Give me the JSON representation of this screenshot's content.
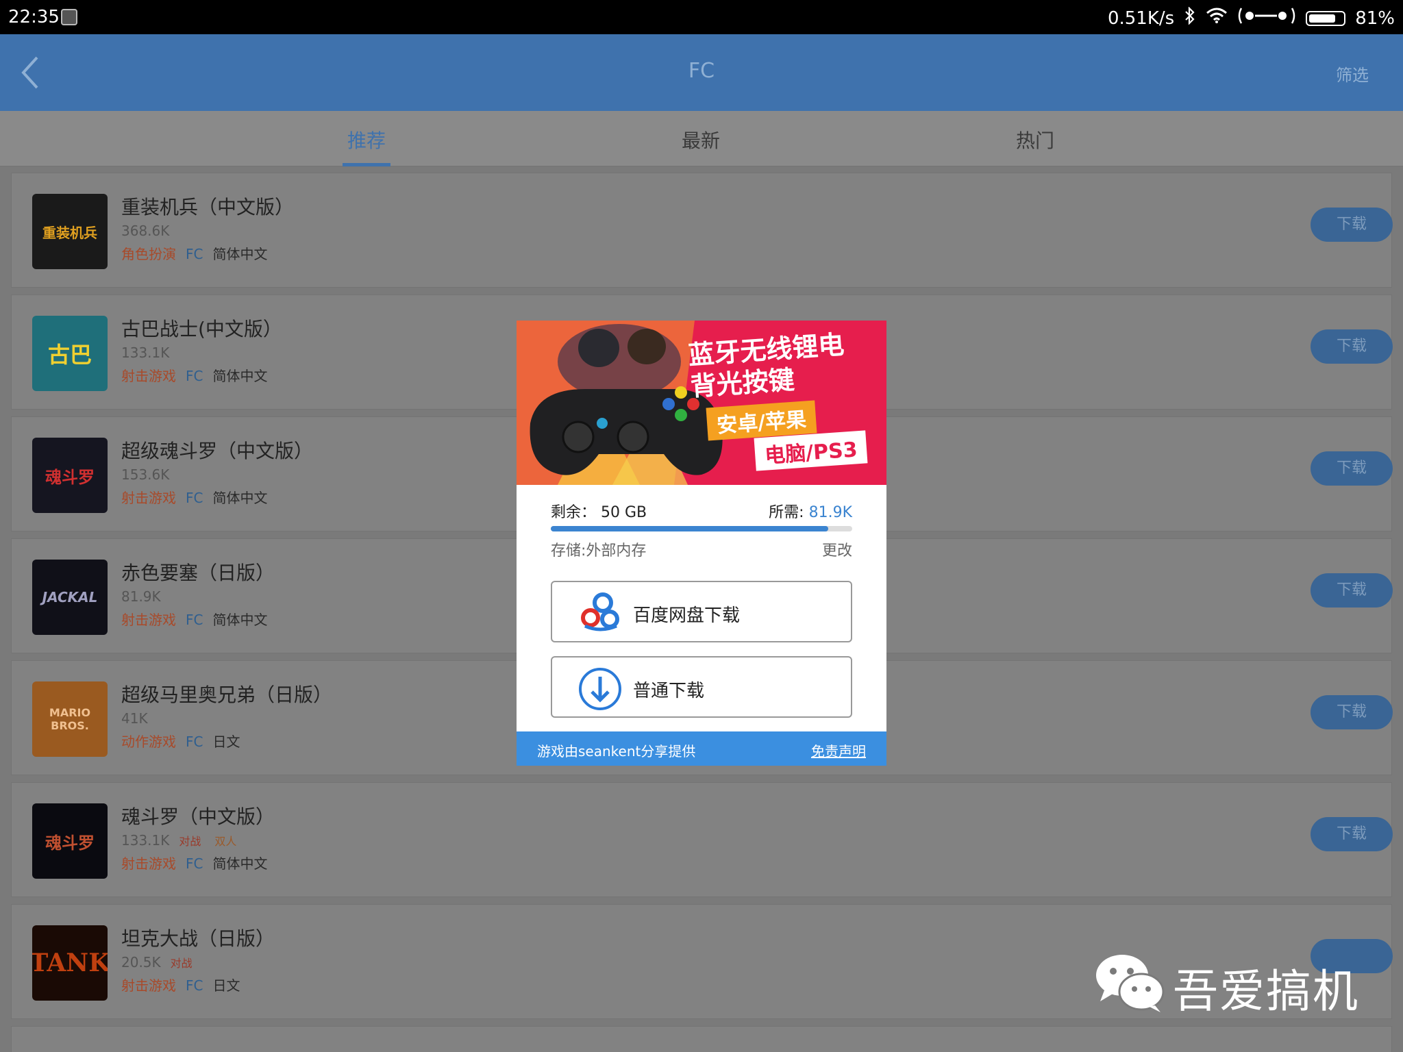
{
  "status_bar": {
    "time": "22:35",
    "net_speed": "0.51K/s",
    "battery": "81%",
    "battery_level": 0.81
  },
  "header": {
    "title": "FC",
    "filter_label": "筛选"
  },
  "tabs": [
    {
      "label": "推荐",
      "active": true
    },
    {
      "label": "最新",
      "active": false
    },
    {
      "label": "热门",
      "active": false
    }
  ],
  "games": [
    {
      "name": "重装机兵（中文版）",
      "size": "368.6K",
      "tags": [],
      "genre": "角色扮演",
      "platform": "FC",
      "language": "简体中文",
      "button": "下载",
      "thumb_text": "重装机兵",
      "thumb_bg": "#1a1a1a",
      "thumb_fg": "#e0a020"
    },
    {
      "name": "古巴战士(中文版）",
      "size": "133.1K",
      "tags": [],
      "genre": "射击游戏",
      "platform": "FC",
      "language": "简体中文",
      "button": "下载",
      "thumb_text": "古巴",
      "thumb_bg": "#1f6f7a",
      "thumb_fg": "#f0d030"
    },
    {
      "name": "超级魂斗罗（中文版）",
      "size": "153.6K",
      "tags": [],
      "genre": "射击游戏",
      "platform": "FC",
      "language": "简体中文",
      "button": "下载",
      "thumb_text": "魂斗罗",
      "thumb_bg": "#151520",
      "thumb_fg": "#d03030"
    },
    {
      "name": "赤色要塞（日版）",
      "size": "81.9K",
      "tags": [],
      "genre": "射击游戏",
      "platform": "FC",
      "language": "简体中文",
      "button": "下载",
      "thumb_text": "JACKAL",
      "thumb_bg": "#101018",
      "thumb_fg": "#a0a0c0"
    },
    {
      "name": "超级马里奥兄弟（日版）",
      "size": "41K",
      "tags": [],
      "genre": "动作游戏",
      "platform": "FC",
      "language": "日文",
      "button": "下载",
      "thumb_text": "MARIO BROS.",
      "thumb_bg": "#9a5a20",
      "thumb_fg": "#f0c090"
    },
    {
      "name": "魂斗罗（中文版）",
      "size": "133.1K",
      "tags": [
        "对战",
        "双人"
      ],
      "genre": "射击游戏",
      "platform": "FC",
      "language": "简体中文",
      "button": "下载",
      "thumb_text": "魂斗罗",
      "thumb_bg": "#0a0a10",
      "thumb_fg": "#c05030"
    },
    {
      "name": "坦克大战（日版）",
      "size": "20.5K",
      "tags": [
        "对战"
      ],
      "genre": "射击游戏",
      "platform": "FC",
      "language": "日文",
      "button": "",
      "thumb_text": "TANK",
      "thumb_bg": "#1a0a05",
      "thumb_fg": "#c04010"
    }
  ],
  "modal": {
    "banner": {
      "line1": "蓝牙无线锂电",
      "line2": "背光按键",
      "tag1": "安卓/苹果",
      "tag2": "电脑/PS3"
    },
    "remaining_label": "剩余：",
    "remaining_value": "50 GB",
    "required_label": "所需:",
    "required_value": "81.9K",
    "storage_fill": 0.92,
    "storage_location": "存储:外部内存",
    "change_label": "更改",
    "baidu_button": "百度网盘下载",
    "normal_button": "普通下载",
    "footer_provider": "游戏由seankent分享提供",
    "footer_disclaimer": "免责声明"
  },
  "watermark": {
    "text": "吾爱搞机",
    "icon": "wechat-icon"
  },
  "colors": {
    "header_blue": "#3f72ad",
    "accent_blue": "#3b84d0",
    "genre_orange": "#e8763a"
  }
}
